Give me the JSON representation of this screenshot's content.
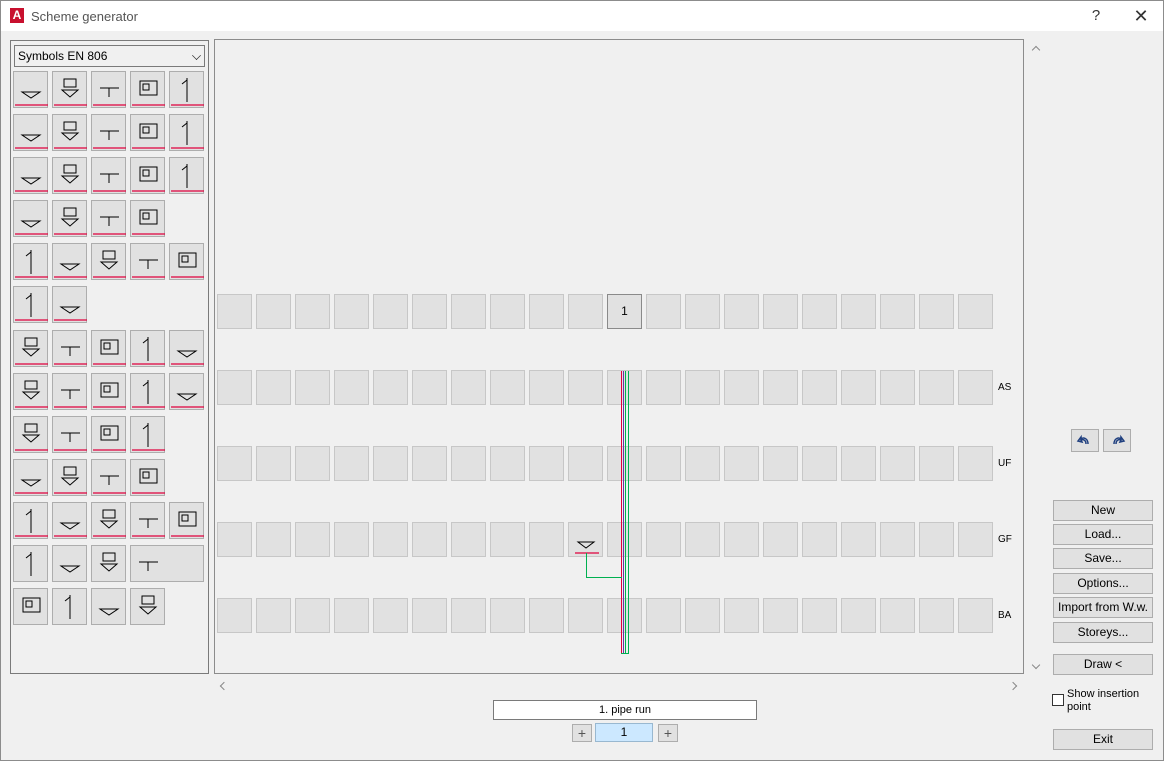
{
  "window": {
    "title": "Scheme generator",
    "help_icon": "?",
    "close_icon": "✕",
    "app_letter": "A"
  },
  "palette": {
    "selected_symbol_set": "Symbols EN 806"
  },
  "canvas": {
    "header_number": "1",
    "storeys": [
      "AS",
      "UF",
      "GF",
      "BA"
    ],
    "pipe_colors": {
      "red": "#e0003c",
      "green": "#00b050",
      "purple": "#7030a0"
    }
  },
  "buttons": {
    "new": "New",
    "load": "Load...",
    "save": "Save...",
    "options": "Options...",
    "import": "Import from W.w.",
    "storeys": "Storeys...",
    "draw": "Draw <",
    "exit": "Exit"
  },
  "show_insertion_point": {
    "label": "Show insertion point",
    "checked": false
  },
  "pipe_run": {
    "name": "1. pipe run",
    "page": "1",
    "minus": "+",
    "plus": "+"
  },
  "accent_colors": {
    "red_line": "#e0003c",
    "selection": "#cce8ff"
  }
}
